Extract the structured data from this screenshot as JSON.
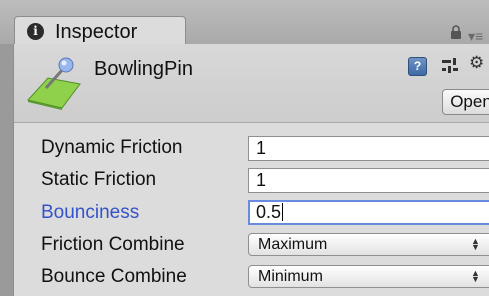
{
  "window": {
    "tab_title": "Inspector"
  },
  "header": {
    "asset_name": "BowlingPin",
    "open_label": "Open"
  },
  "icons": {
    "tab": "info-icon",
    "lock": "lock-icon",
    "tab_menu": "tab-menu-icon",
    "asset": "physic-material-icon",
    "help": "help-icon",
    "settings": "preset-settings-icon",
    "gear": "gear-icon"
  },
  "properties": {
    "dynamic_friction": {
      "label": "Dynamic Friction",
      "value": "1"
    },
    "static_friction": {
      "label": "Static Friction",
      "value": "1"
    },
    "bounciness": {
      "label": "Bounciness",
      "value": "0.5"
    },
    "friction_combine": {
      "label": "Friction Combine",
      "value": "Maximum"
    },
    "bounce_combine": {
      "label": "Bounce Combine",
      "value": "Minimum"
    }
  },
  "colors": {
    "active_label": "#3553c9",
    "focus_border": "#6a8ae0",
    "panel_bg": "#dcdcdc"
  }
}
